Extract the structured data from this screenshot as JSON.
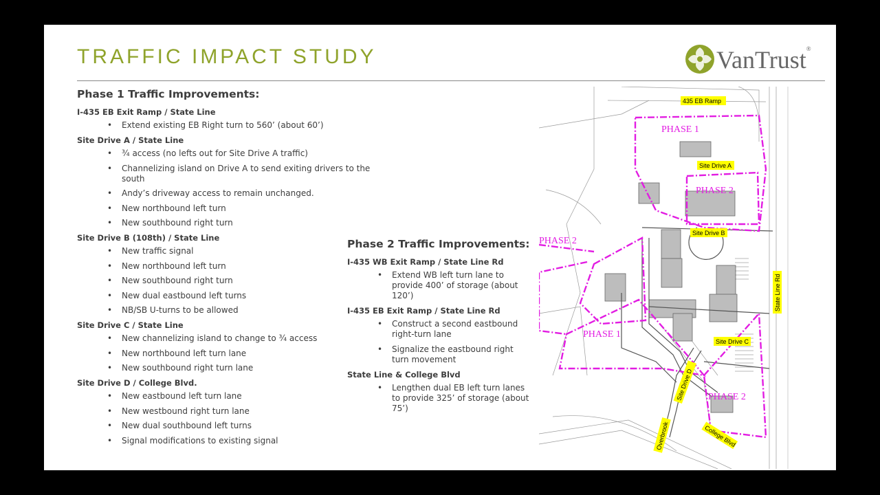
{
  "title": "TRAFFIC IMPACT STUDY",
  "logo": {
    "text": "VanTrust",
    "reg": "®"
  },
  "phase1": {
    "heading": "Phase 1 Traffic Improvements:",
    "sections": [
      {
        "title": "I-435 EB Exit Ramp / State Line",
        "items": [
          "Extend existing EB Right turn to 560’ (about 60’)"
        ]
      },
      {
        "title": "Site Drive A / State Line",
        "items": [
          "¾ access (no lefts out for Site Drive A traffic)",
          "Channelizing island on Drive A to send exiting drivers to the south",
          "Andy’s driveway access to remain unchanged.",
          "New northbound left turn",
          "New southbound right turn"
        ]
      },
      {
        "title": "Site Drive B (108th) / State Line",
        "items": [
          "New traffic signal",
          "New northbound left turn",
          "New southbound right turn",
          "New dual eastbound left turns",
          "NB/SB U-turns to be allowed"
        ]
      },
      {
        "title": "Site Drive C / State Line",
        "items": [
          "New channelizing island to change to ¾ access",
          "New northbound left turn lane",
          "New southbound right turn lane"
        ]
      },
      {
        "title": "Site Drive D / College Blvd.",
        "items": [
          "New eastbound left turn lane",
          "New westbound right turn lane",
          "New dual southbound left turns",
          "Signal modifications to existing signal"
        ]
      }
    ]
  },
  "phase2": {
    "heading": "Phase 2 Traffic Improvements:",
    "sections": [
      {
        "title": "I-435 WB Exit Ramp / State Line Rd",
        "items": [
          "Extend WB left turn lane to provide 400’ of storage (about 120’)"
        ]
      },
      {
        "title": "I-435 EB Exit Ramp / State Line Rd",
        "items": [
          "Construct a second eastbound right-turn lane",
          "Signalize the eastbound right turn movement"
        ]
      },
      {
        "title": "State Line & College Blvd",
        "items": [
          "Lengthen dual EB left turn lanes to provide 325’ of storage (about 75’)"
        ]
      }
    ]
  },
  "map": {
    "labels": {
      "ramp": "435 EB Ramp",
      "driveA": "Site Drive A",
      "driveB": "Site Drive B",
      "driveC": "Site Drive C",
      "driveD": "Site Drive D",
      "stateLine": "State Line Rd",
      "overbrook": "Overbrook",
      "college": "College Blvd"
    },
    "phases": {
      "p1a": "PHASE 1",
      "p2a": "PHASE 2",
      "p2b": "PHASE 2",
      "p1b": "PHASE 1",
      "p2c": "PHASE 2"
    },
    "colors": {
      "phase": "#e21ce2",
      "label_bg": "#ffff00"
    }
  }
}
